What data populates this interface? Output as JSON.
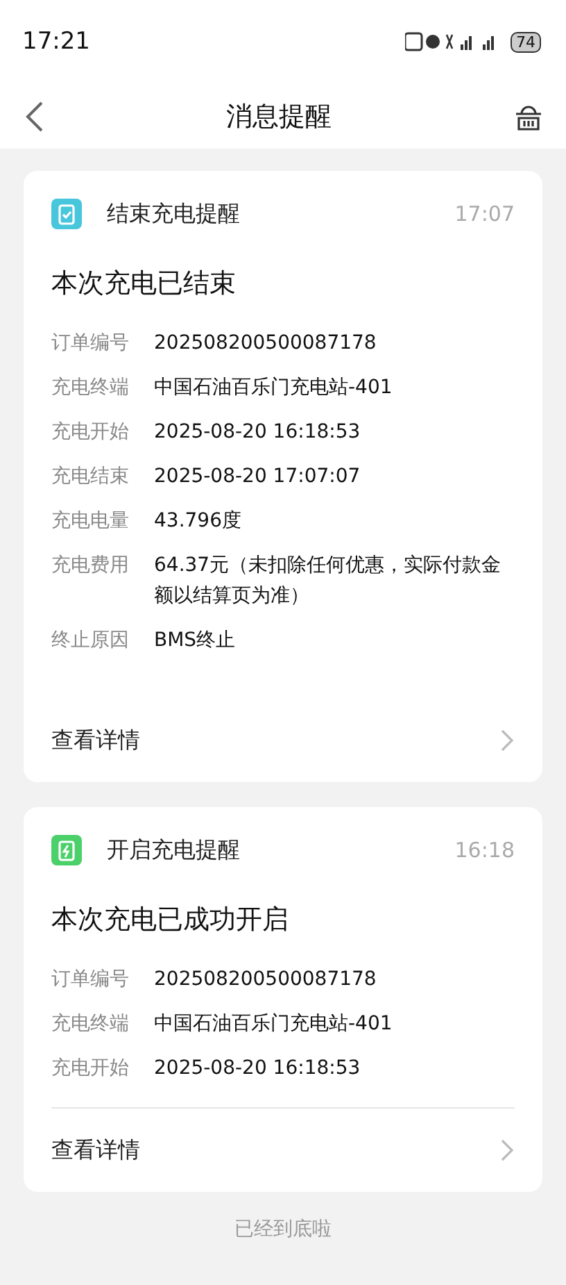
{
  "status_bar": {
    "time": "17:21",
    "battery": "74"
  },
  "nav": {
    "title": "消息提醒"
  },
  "cards": [
    {
      "kind": "end",
      "title": "结束充电提醒",
      "time": "17:07",
      "headline": "本次充电已结束",
      "footer_divider": false,
      "link": "查看详情",
      "fields": [
        {
          "label": "订单编号",
          "value": "202508200500087178"
        },
        {
          "label": "充电终端",
          "value": "中国石油百乐门充电站-401"
        },
        {
          "label": "充电开始",
          "value": "2025-08-20 16:18:53"
        },
        {
          "label": "充电结束",
          "value": "2025-08-20 17:07:07"
        },
        {
          "label": "充电电量",
          "value": "43.796度"
        },
        {
          "label": "充电费用",
          "value": "64.37元（未扣除任何优惠，实际付款金额以结算页为准）"
        },
        {
          "label": "终止原因",
          "value": "BMS终止"
        }
      ]
    },
    {
      "kind": "start",
      "title": "开启充电提醒",
      "time": "16:18",
      "headline": "本次充电已成功开启",
      "footer_divider": true,
      "link": "查看详情",
      "fields": [
        {
          "label": "订单编号",
          "value": "202508200500087178"
        },
        {
          "label": "充电终端",
          "value": "中国石油百乐门充电站-401"
        },
        {
          "label": "充电开始",
          "value": "2025-08-20 16:18:53"
        }
      ]
    }
  ],
  "end_note": "已经到底啦"
}
